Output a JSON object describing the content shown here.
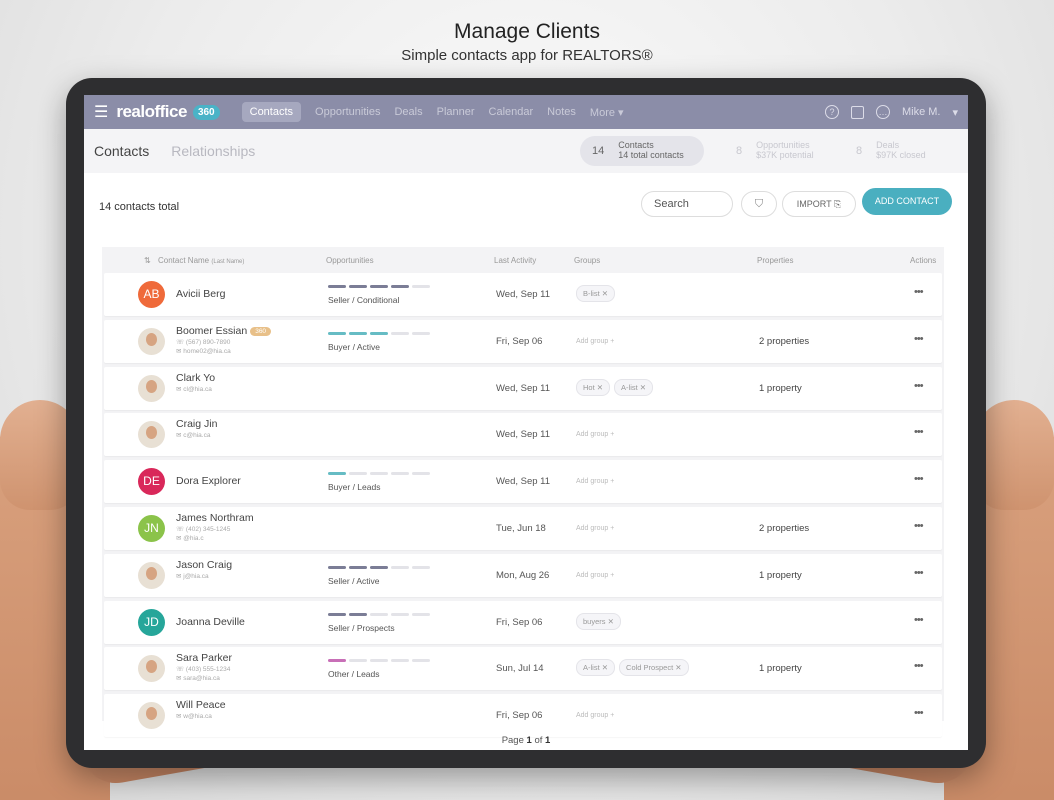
{
  "hero": {
    "title": "Manage Clients",
    "subtitle": "Simple contacts app for REALTORS®"
  },
  "app": {
    "logo_text": "realoffice",
    "logo_badge": "360",
    "nav_tabs": [
      "Contacts",
      "Opportunities",
      "Deals",
      "Planner",
      "Calendar",
      "Notes",
      "More ▾"
    ],
    "user": "Mike M.",
    "nav_icons": [
      "help-icon",
      "calendar-icon",
      "chat-icon"
    ]
  },
  "subheader": {
    "tabs": [
      "Contacts",
      "Relationships"
    ],
    "stats": [
      {
        "num": "14",
        "label": "Contacts",
        "sub": "14 total contacts"
      },
      {
        "num": "8",
        "label": "Opportunities",
        "sub": "$37K potential"
      },
      {
        "num": "8",
        "label": "Deals",
        "sub": "$97K closed"
      }
    ]
  },
  "toolbar": {
    "total": "14 contacts total",
    "search_placeholder": "Search",
    "import_label": "IMPORT",
    "add_label": "ADD CONTACT"
  },
  "table": {
    "headers": {
      "name": "Contact Name",
      "name_sub": "(Last Name)",
      "opportunities": "Opportunities",
      "last_activity": "Last Activity",
      "groups": "Groups",
      "properties": "Properties",
      "actions": "Actions"
    },
    "rows": [
      {
        "initials": "AB",
        "color": "#ef6a3a",
        "name": "Avicii Berg",
        "badge": "",
        "phone": "",
        "email": "",
        "opp_filled": 4,
        "opp_color": "#7b7d96",
        "opp_label": "Seller / Conditional",
        "last": "Wed, Sep 11",
        "groups": [
          "B-list ✕"
        ],
        "add_group": "",
        "props": ""
      },
      {
        "initials": "",
        "color": "",
        "name": "Boomer Essian",
        "badge": "360",
        "phone": "☏ (567) 890-7890",
        "email": "✉ home02@hia.ca",
        "opp_filled": 3,
        "opp_color": "#66bcc4",
        "opp_label": "Buyer / Active",
        "last": "Fri, Sep 06",
        "groups": [],
        "add_group": "Add group +",
        "props": "2 properties"
      },
      {
        "initials": "",
        "color": "",
        "name": "Clark Yo",
        "badge": "",
        "phone": "",
        "email": "✉ cl@hia.ca",
        "opp_filled": 0,
        "opp_color": "",
        "opp_label": "",
        "last": "Wed, Sep 11",
        "groups": [
          "Hot ✕",
          "A-list ✕"
        ],
        "add_group": "",
        "props": "1 property"
      },
      {
        "initials": "",
        "color": "",
        "name": "Craig Jin",
        "badge": "",
        "phone": "",
        "email": "✉ c@hia.ca",
        "opp_filled": 0,
        "opp_color": "",
        "opp_label": "",
        "last": "Wed, Sep 11",
        "groups": [],
        "add_group": "Add group +",
        "props": ""
      },
      {
        "initials": "DE",
        "color": "#d9285a",
        "name": "Dora Explorer",
        "badge": "",
        "phone": "",
        "email": "",
        "opp_filled": 1,
        "opp_color": "#66bcc4",
        "opp_label": "Buyer / Leads",
        "last": "Wed, Sep 11",
        "groups": [],
        "add_group": "Add group +",
        "props": ""
      },
      {
        "initials": "JN",
        "color": "#8bc34a",
        "name": "James Northram",
        "badge": "",
        "phone": "☏ (402) 345-1245",
        "email": "✉ @hia.c",
        "opp_filled": 0,
        "opp_color": "",
        "opp_label": "",
        "last": "Tue, Jun 18",
        "groups": [],
        "add_group": "Add group +",
        "props": "2 properties"
      },
      {
        "initials": "",
        "color": "",
        "name": "Jason Craig",
        "badge": "",
        "phone": "",
        "email": "✉ j@hia.ca",
        "opp_filled": 3,
        "opp_color": "#7b7d96",
        "opp_label": "Seller / Active",
        "last": "Mon, Aug 26",
        "groups": [],
        "add_group": "Add group +",
        "props": "1 property"
      },
      {
        "initials": "JD",
        "color": "#26a69a",
        "name": "Joanna Deville",
        "badge": "",
        "phone": "",
        "email": "",
        "opp_filled": 2,
        "opp_color": "#7b7d96",
        "opp_label": "Seller / Prospects",
        "last": "Fri, Sep 06",
        "groups": [
          "buyers ✕"
        ],
        "add_group": "",
        "props": ""
      },
      {
        "initials": "",
        "color": "",
        "name": "Sara Parker",
        "badge": "",
        "phone": "☏ (403) 555-1234",
        "email": "✉ sara@hia.ca",
        "opp_filled": 1,
        "opp_color": "#c86fb7",
        "opp_label": "Other / Leads",
        "last": "Sun, Jul 14",
        "groups": [
          "A-list ✕",
          "Cold Prospect ✕"
        ],
        "add_group": "",
        "props": "1 property"
      },
      {
        "initials": "",
        "color": "",
        "name": "Will Peace",
        "badge": "",
        "phone": "",
        "email": "✉ w@hia.ca",
        "opp_filled": 0,
        "opp_color": "",
        "opp_label": "",
        "last": "Fri, Sep 06",
        "groups": [],
        "add_group": "Add group +",
        "props": ""
      }
    ]
  },
  "pager": {
    "prefix": "Page ",
    "current": "1",
    "sep": " of ",
    "total": "1"
  }
}
